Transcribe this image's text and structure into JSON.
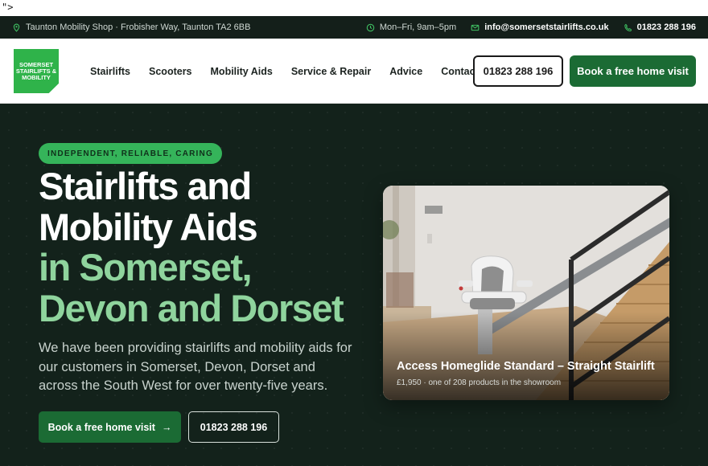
{
  "stray_text": "\">",
  "topbar": {
    "address": "Taunton Mobility Shop · Frobisher Way, Taunton TA2 6BB",
    "hours": "Mon–Fri, 9am–5pm",
    "email": "info@somersetstairlifts.co.uk",
    "phone": "01823 288 196"
  },
  "header": {
    "logo_text": "SOMERSET\nSTAIRLIFTS &\nMOBILITY",
    "nav": [
      "Stairlifts",
      "Scooters",
      "Mobility Aids",
      "Service & Repair",
      "Advice",
      "Contact"
    ],
    "phone_button": "01823 288 196",
    "book_button": "Book a free home visit"
  },
  "hero": {
    "badge": "INDEPENDENT, RELIABLE, CARING",
    "headline_white_1": "Stairlifts and",
    "headline_white_2": "Mobility Aids",
    "headline_green_1": "in Somerset,",
    "headline_green_2": "Devon and Dorset",
    "lede": "We have been providing stairlifts and mobility aids for our customers in Somerset, Devon, Dorset and across the South West for over twenty-five years.",
    "book_button": "Book a free home visit",
    "book_arrow": "→",
    "phone_button": "01823 288 196"
  },
  "product": {
    "title": "Access Homeglide Standard – Straight Stairlift",
    "meta": "£1,950 · one of 208 products in the showroom"
  },
  "colors": {
    "topbar_bg": "#141f1a",
    "hero_bg": "#13221b",
    "brand_green": "#1b6b34",
    "badge_green": "#35b45a",
    "headline_green": "#8fd49d"
  },
  "icons": {
    "address": "map-pin-icon",
    "hours": "clock-icon",
    "email": "mail-icon",
    "phone": "phone-icon"
  }
}
